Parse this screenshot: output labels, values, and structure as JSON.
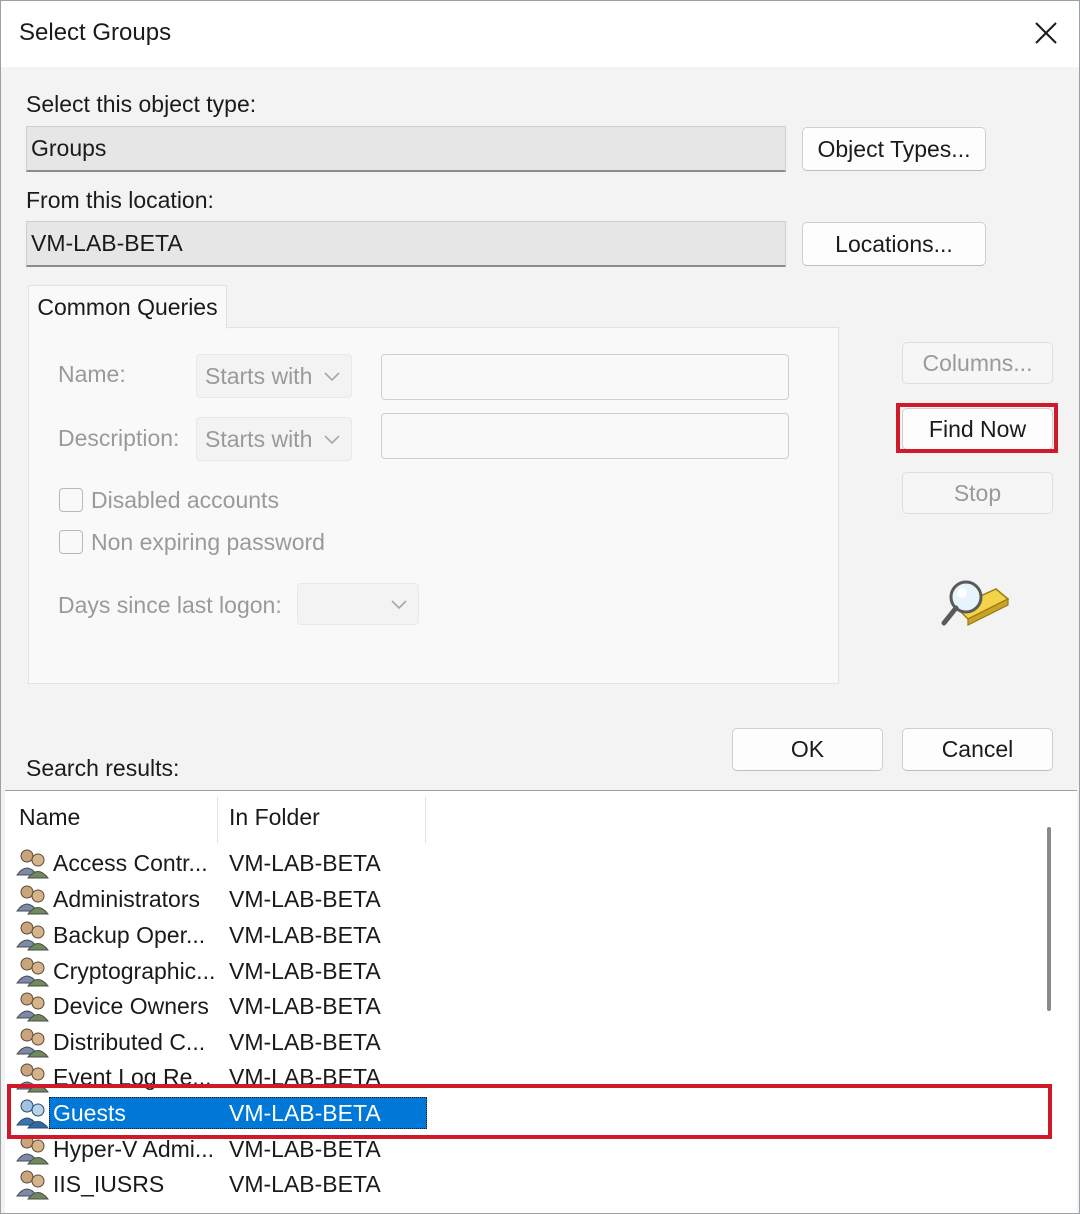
{
  "window": {
    "title": "Select Groups"
  },
  "object_type": {
    "label": "Select this object type:",
    "value": "Groups",
    "button": "Object Types..."
  },
  "location": {
    "label": "From this location:",
    "value": "VM-LAB-BETA",
    "button": "Locations..."
  },
  "queries": {
    "tab": "Common Queries",
    "name_label": "Name:",
    "name_mode": "Starts with",
    "description_label": "Description:",
    "description_mode": "Starts with",
    "disabled_accounts": "Disabled accounts",
    "non_expiring": "Non expiring password",
    "days_label": "Days since last logon:"
  },
  "actions": {
    "columns": "Columns...",
    "find_now": "Find Now",
    "stop": "Stop",
    "ok": "OK",
    "cancel": "Cancel"
  },
  "results": {
    "label": "Search results:",
    "columns": [
      "Name",
      "In Folder"
    ],
    "rows": [
      {
        "name": "Access Contr...",
        "folder": "VM-LAB-BETA"
      },
      {
        "name": "Administrators",
        "folder": "VM-LAB-BETA"
      },
      {
        "name": "Backup Oper...",
        "folder": "VM-LAB-BETA"
      },
      {
        "name": "Cryptographic...",
        "folder": "VM-LAB-BETA"
      },
      {
        "name": "Device Owners",
        "folder": "VM-LAB-BETA"
      },
      {
        "name": "Distributed C...",
        "folder": "VM-LAB-BETA"
      },
      {
        "name": "Event Log Re...",
        "folder": "VM-LAB-BETA"
      },
      {
        "name": "Guests",
        "folder": "VM-LAB-BETA",
        "selected": true
      },
      {
        "name": "Hyper-V Admi...",
        "folder": "VM-LAB-BETA"
      },
      {
        "name": "IIS_IUSRS",
        "folder": "VM-LAB-BETA"
      }
    ]
  },
  "colors": {
    "highlight": "#d0192b",
    "selection": "#0078d7"
  }
}
